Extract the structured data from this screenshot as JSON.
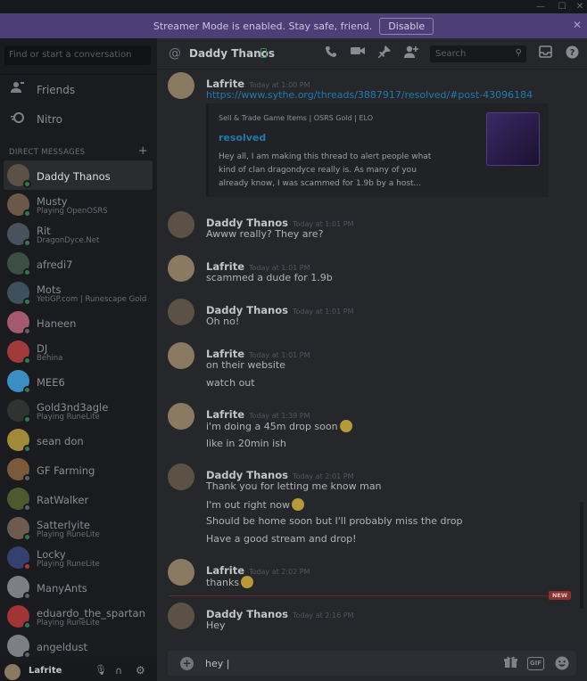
{
  "window": {
    "minimize": "—",
    "maximize": "☐",
    "close": "✕"
  },
  "banner": {
    "text": "Streamer Mode is enabled. Stay safe, friend.",
    "button": "Disable",
    "close": "✕"
  },
  "sidebar": {
    "search_placeholder": "Find or start a conversation",
    "nav": [
      {
        "label": "Friends",
        "icon": "friends-icon"
      },
      {
        "label": "Nitro",
        "icon": "nitro-icon"
      }
    ],
    "dm_header": "DIRECT MESSAGES",
    "dm_add": "+",
    "dms": [
      {
        "name": "Daddy Thanos",
        "sub": "",
        "status": "online",
        "color": "#5b5144",
        "active": true
      },
      {
        "name": "Musty",
        "sub": "Playing OpenOSRS",
        "status": "online",
        "color": "#6b5848"
      },
      {
        "name": "Rit",
        "sub": "DragonDyce.Net",
        "status": "online",
        "color": "#47525d"
      },
      {
        "name": "afredi7",
        "sub": "",
        "status": "online",
        "color": "#3d4e44"
      },
      {
        "name": "Mots",
        "sub": "YetiGP.com | Runescape Gold",
        "status": "online",
        "color": "#3e4f5e"
      },
      {
        "name": "Haneen",
        "sub": "",
        "status": "offline",
        "color": "#a35a6f"
      },
      {
        "name": "DJ",
        "sub": "Behina",
        "status": "online",
        "color": "#a13b3b"
      },
      {
        "name": "MEE6",
        "sub": "",
        "status": "online",
        "color": "#3b8ec4"
      },
      {
        "name": "Gold3nd3agle",
        "sub": "Playing RuneLite",
        "status": "online",
        "color": "#2f3432"
      },
      {
        "name": "sean don",
        "sub": "",
        "status": "online",
        "color": "#a08a3a"
      },
      {
        "name": "GF Farming",
        "sub": "",
        "status": "offline",
        "color": "#7a5a3a"
      },
      {
        "name": "RatWalker",
        "sub": "",
        "status": "offline",
        "color": "#4d5a2f"
      },
      {
        "name": "Satterlyite",
        "sub": "Playing RuneLite",
        "status": "online",
        "color": "#6e5a4e"
      },
      {
        "name": "Locky",
        "sub": "Playing RuneLite",
        "status": "dnd",
        "color": "#34406e"
      },
      {
        "name": "ManyAnts",
        "sub": "",
        "status": "offline",
        "color": "#7d7f85"
      },
      {
        "name": "eduardo_the_spartan",
        "sub": "Playing RuneLite",
        "status": "online",
        "color": "#a13434"
      },
      {
        "name": "angeldust",
        "sub": "",
        "status": "offline",
        "color": "#7d7f85"
      }
    ],
    "user": {
      "name": "Lafrite"
    }
  },
  "channel": {
    "name": "Daddy Thanos",
    "search_placeholder": "Search"
  },
  "messages": [
    {
      "author": "Lafrite",
      "time": "Today at 1:00 PM",
      "avatar_color": "#8a7a62",
      "lines": [
        {
          "text": "https://www.sythe.org/threads/3887917/resolved/#post-43096184",
          "link": true
        }
      ],
      "embed": {
        "provider": "Sell & Trade Game Items | OSRS Gold | ELO",
        "title": "resolved",
        "description": "Hey all, I am making this thread to alert people what kind of clan dragondyce really is. As many of you already know, I was scammed for 1.9b by a host..."
      }
    },
    {
      "author": "Daddy Thanos",
      "time": "Today at 1:01 PM",
      "avatar_color": "#5b5144",
      "lines": [
        {
          "text": "Awww really? They are?"
        }
      ]
    },
    {
      "author": "Lafrite",
      "time": "Today at 1:01 PM",
      "avatar_color": "#8a7a62",
      "lines": [
        {
          "text": "scammed a dude for 1.9b"
        }
      ]
    },
    {
      "author": "Daddy Thanos",
      "time": "Today at 1:01 PM",
      "avatar_color": "#5b5144",
      "lines": [
        {
          "text": "Oh no!"
        }
      ]
    },
    {
      "author": "Lafrite",
      "time": "Today at 1:01 PM",
      "avatar_color": "#8a7a62",
      "lines": [
        {
          "text": "on their website"
        },
        {
          "text": "watch out"
        }
      ]
    },
    {
      "author": "Lafrite",
      "time": "Today at 1:39 PM",
      "avatar_color": "#8a7a62",
      "lines": [
        {
          "text": "i'm doing a 45m drop soon",
          "emoji": true
        },
        {
          "text": "like in 20min ish"
        }
      ]
    },
    {
      "author": "Daddy Thanos",
      "time": "Today at 2:01 PM",
      "avatar_color": "#5b5144",
      "lines": [
        {
          "text": "Thank you for letting me know man"
        },
        {
          "text": "I'm out right now",
          "emoji": true
        },
        {
          "text": "Should be home soon but I'll probably miss the drop"
        },
        {
          "text": "Have a good stream and drop!"
        }
      ]
    },
    {
      "author": "Lafrite",
      "time": "Today at 2:02 PM",
      "avatar_color": "#8a7a62",
      "lines": [
        {
          "text": "thanks",
          "emoji": true
        }
      ]
    },
    {
      "author": "Daddy Thanos",
      "time": "Today at 2:16 PM",
      "avatar_color": "#5b5144",
      "lines": [
        {
          "text": "Hey"
        }
      ]
    }
  ],
  "new_marker": "NEW",
  "composer": {
    "draft": "hey |",
    "plus": "+",
    "gif": "GIF"
  },
  "colors": {
    "accent": "#1f7bb0",
    "banner": "#4d3e78",
    "online": "#2c7a4f",
    "dnd": "#a83a3a"
  }
}
